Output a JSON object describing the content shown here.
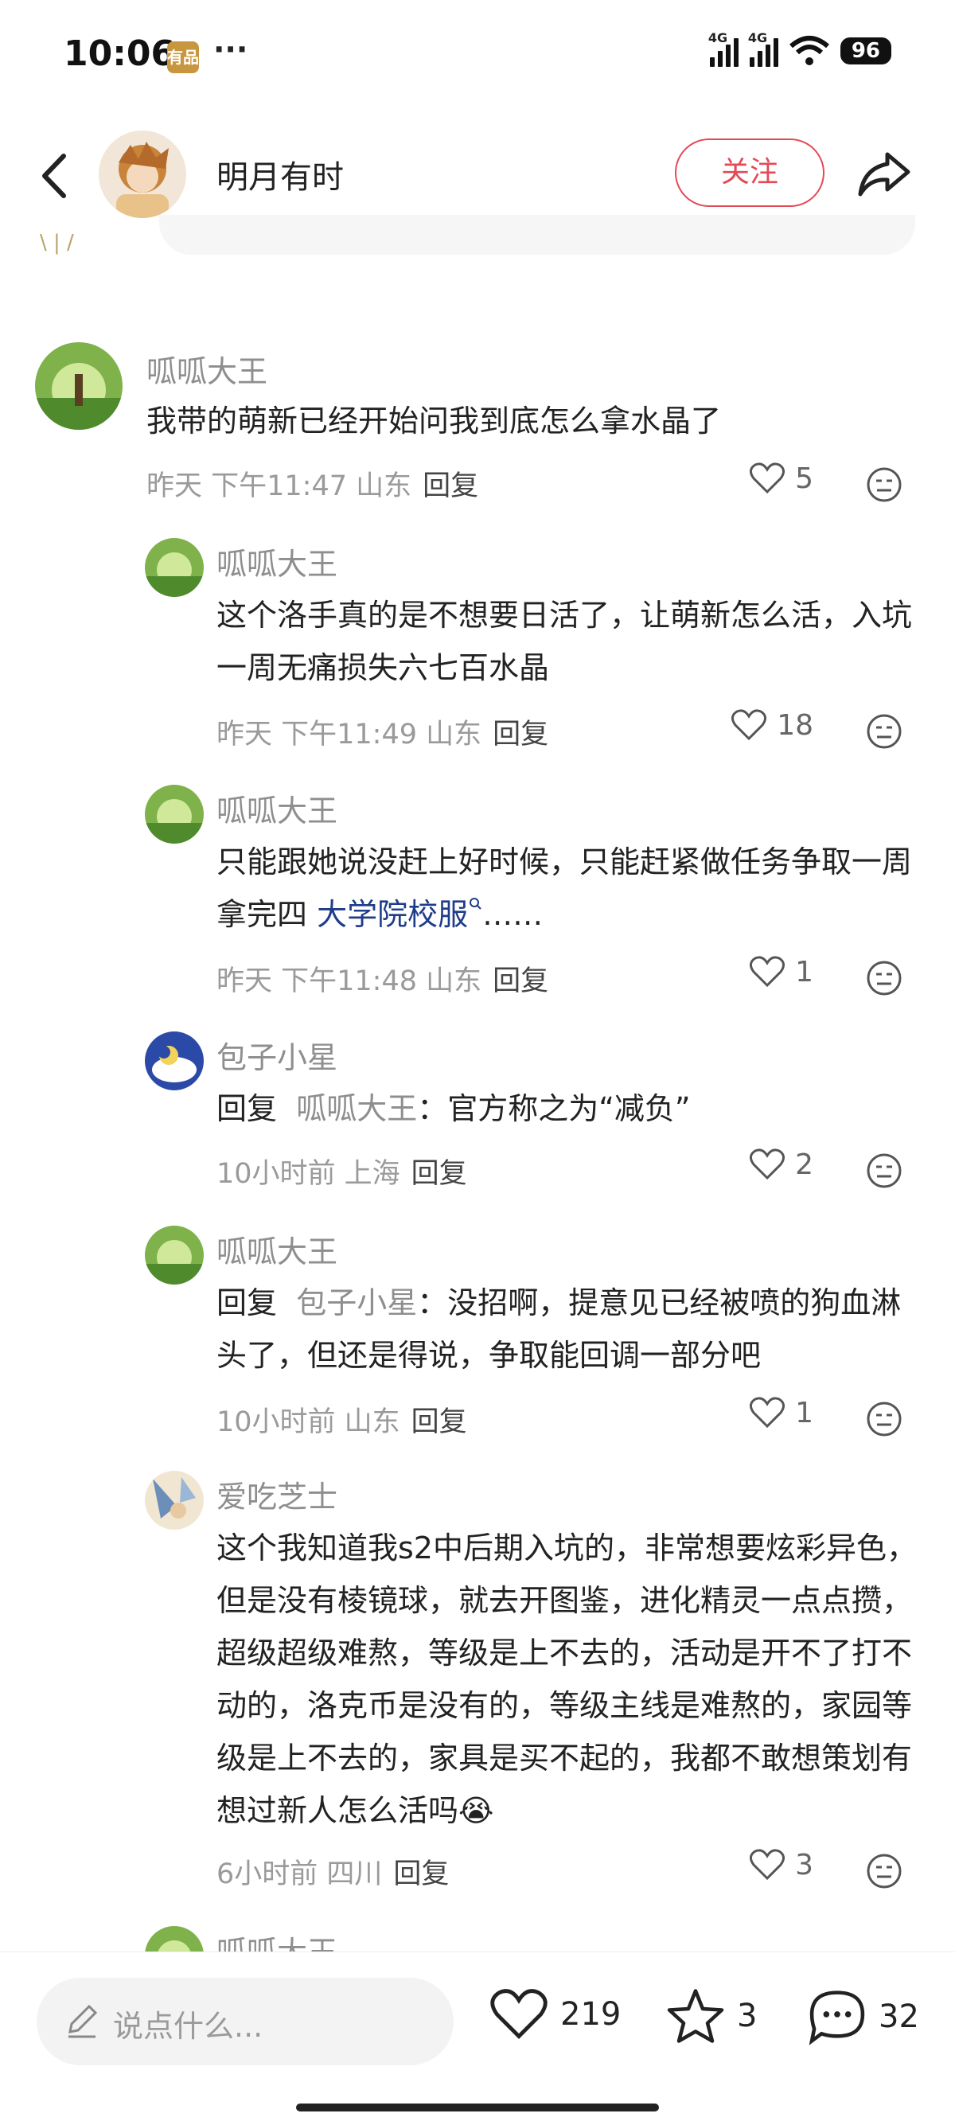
{
  "status_bar": {
    "time": "10:06",
    "badge": "有品",
    "dots": "···",
    "net1": "4G",
    "net2": "4G",
    "battery": "96"
  },
  "header": {
    "author": "明月有时",
    "follow_label": "关注"
  },
  "comments": [
    {
      "name": "呱呱大王",
      "text": "我带的萌新已经开始问我到底怎么拿水晶了",
      "time": "昨天 下午11:47 山东",
      "reply": "回复",
      "likes": "5"
    },
    {
      "name": "呱呱大王",
      "text": "这个洛手真的是不想要日活了，让萌新怎么活，入坑一周无痛损失六七百水晶",
      "time": "昨天 下午11:49 山东",
      "reply": "回复",
      "likes": "18"
    },
    {
      "name": "呱呱大王",
      "text_before": "只能跟她说没赶上好时候，只能赶紧做任务争取一周拿完四 ",
      "link": "大学院校服",
      "text_after": "……",
      "time": "昨天 下午11:48 山东",
      "reply": "回复",
      "likes": "1"
    },
    {
      "name": "包子小星",
      "reply_prefix": "回复",
      "reply_to": "呱呱大王",
      "text": "：官方称之为“减负”",
      "time": "10小时前 上海",
      "reply": "回复",
      "likes": "2"
    },
    {
      "name": "呱呱大王",
      "reply_prefix": "回复",
      "reply_to": "包子小星",
      "text": "：没招啊，提意见已经被喷的狗血淋头了，但还是得说，争取能回调一部分吧",
      "time": "10小时前 山东",
      "reply": "回复",
      "likes": "1"
    },
    {
      "name": "爱吃芝士",
      "text": "这个我知道我s2中后期入坑的，非常想要炫彩异色，但是没有棱镜球，就去开图鉴，进化精灵一点点攒，超级超级难熬，等级是上不去的，活动是开不了打不动的，洛克币是没有的，等级主线是难熬的，家园等级是上不去的，家具是买不起的，我都不敢想策划有想过新人怎么活吗",
      "emoji": "😭",
      "time": "6小时前 四川",
      "reply": "回复",
      "likes": "3"
    },
    {
      "name": "呱呱大王"
    }
  ],
  "bottom_bar": {
    "placeholder": "说点什么...",
    "likes": "219",
    "stars": "3",
    "comments": "32"
  },
  "colors": {
    "accent": "#e34a56",
    "link": "#1f3c8a",
    "muted": "#8e8e8e"
  }
}
